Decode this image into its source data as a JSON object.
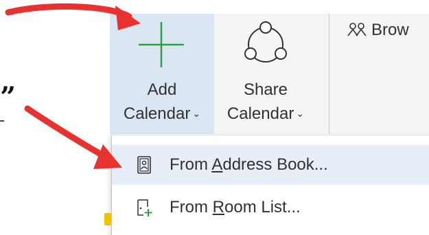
{
  "ribbon": {
    "add_calendar": {
      "line1": "Add",
      "line2": "Calendar",
      "chevron": "⌄",
      "icon": "plus-icon"
    },
    "share_calendar": {
      "line1": "Share",
      "line2": "Calendar",
      "chevron": "⌄",
      "icon": "share-network-icon"
    },
    "browse": {
      "label": "Brow",
      "icon": "people-icon"
    }
  },
  "dropdown": {
    "items": [
      {
        "pre": "From ",
        "accel": "A",
        "post": "ddress Book...",
        "icon": "address-book-icon"
      },
      {
        "pre": "From ",
        "accel": "R",
        "post": "oom List...",
        "icon": "room-list-icon"
      }
    ]
  },
  "annotations": {
    "quote_glyph": "”",
    "arrow_color": "#e8322f"
  },
  "colors": {
    "add_calendar_bg": "#dbe6f3",
    "highlight_bg": "#e8eef7",
    "plus_green": "#2f9e44"
  }
}
